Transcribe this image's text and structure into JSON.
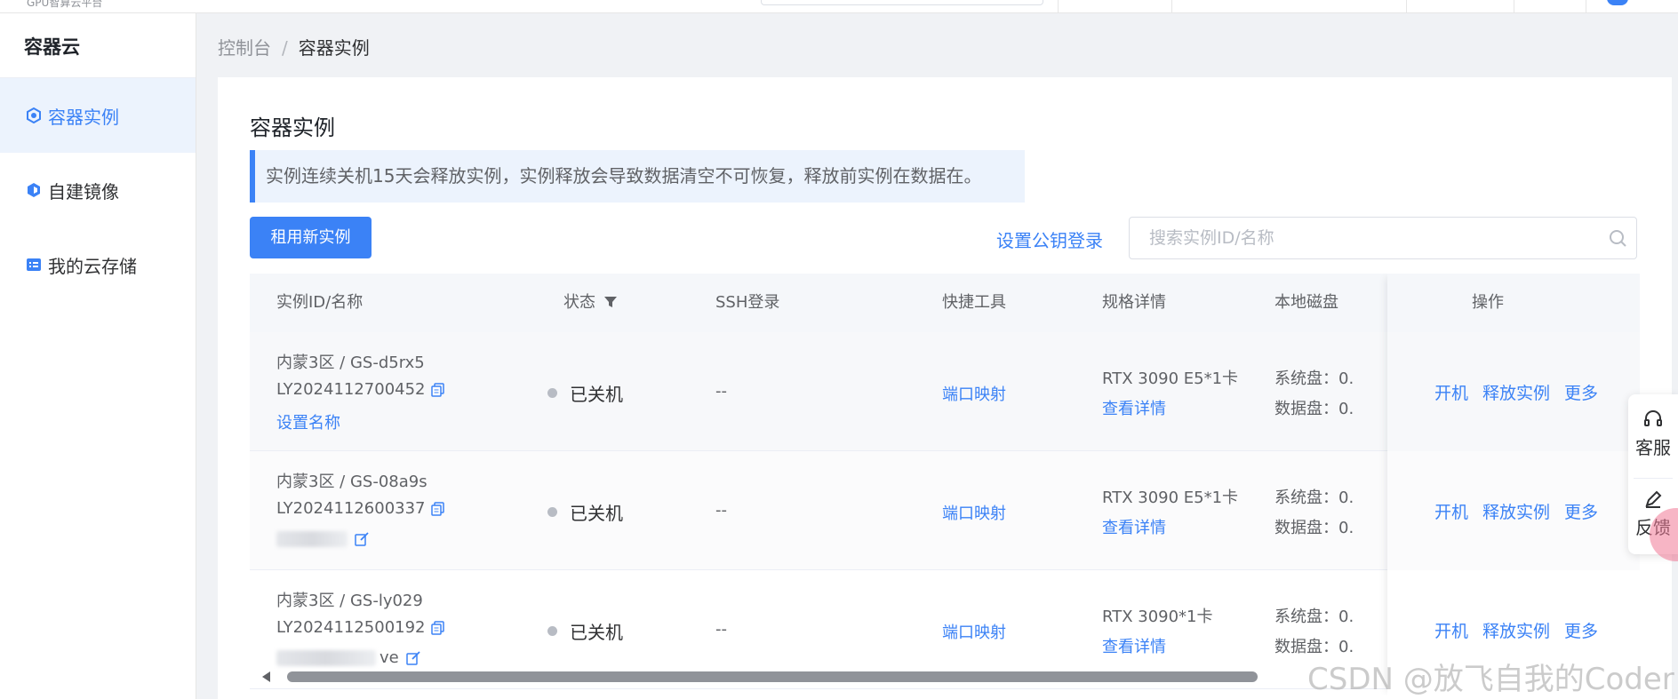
{
  "topbar": {
    "brand": "GPU智算云平台"
  },
  "sidebar": {
    "title": "容器云",
    "items": [
      {
        "label": "容器实例",
        "icon": "container-icon",
        "active": true
      },
      {
        "label": "自建镜像",
        "icon": "image-icon",
        "active": false
      },
      {
        "label": "我的云存储",
        "icon": "storage-icon",
        "active": false
      }
    ]
  },
  "breadcrumb": {
    "root": "控制台",
    "separator": "/",
    "current": "容器实例"
  },
  "main": {
    "title": "容器实例",
    "notice": "实例连续关机15天会释放实例，实例释放会导致数据清空不可恢复，释放前实例在数据在。",
    "new_instance_label": "租用新实例",
    "set_key_login_label": "设置公钥登录",
    "search_placeholder": "搜索实例ID/名称"
  },
  "table": {
    "headers": {
      "id": "实例ID/名称",
      "status": "状态",
      "ssh": "SSH登录",
      "tools": "快捷工具",
      "spec": "规格详情",
      "disk": "本地磁盘",
      "ops": "操作"
    },
    "rows": [
      {
        "region": "内蒙3区 / GS-d5rx5",
        "id": "LY2024112700452",
        "name": "设置名称",
        "name_blurred": false,
        "status": "已关机",
        "ssh": "--",
        "tool": "端口映射",
        "spec": "RTX 3090 E5*1卡",
        "spec_link": "查看详情",
        "disk_sys": "系统盘：0.",
        "disk_data": "数据盘：0.",
        "ops": [
          "开机",
          "释放实例",
          "更多"
        ]
      },
      {
        "region": "内蒙3区 / GS-08a9s",
        "id": "LY2024112600337",
        "name": "",
        "name_blurred": true,
        "status": "已关机",
        "ssh": "--",
        "tool": "端口映射",
        "spec": "RTX 3090 E5*1卡",
        "spec_link": "查看详情",
        "disk_sys": "系统盘：0.",
        "disk_data": "数据盘：0.",
        "ops": [
          "开机",
          "释放实例",
          "更多"
        ]
      },
      {
        "region": "内蒙3区 / GS-ly029",
        "id": "LY2024112500192",
        "name": "ve",
        "name_blurred": true,
        "status": "已关机",
        "ssh": "--",
        "tool": "端口映射",
        "spec": "RTX 3090*1卡",
        "spec_link": "查看详情",
        "disk_sys": "系统盘：0.",
        "disk_data": "数据盘：0.",
        "ops": [
          "开机",
          "释放实例",
          "更多"
        ]
      }
    ]
  },
  "float_panel": {
    "service_label": "客服",
    "feedback_label": "反馈"
  },
  "watermark": "CSDN @放飞自我的Coder",
  "colors": {
    "accent": "#3b82f6",
    "active_bg": "#ecf3fd",
    "status_dot": "#b8bcc4"
  }
}
